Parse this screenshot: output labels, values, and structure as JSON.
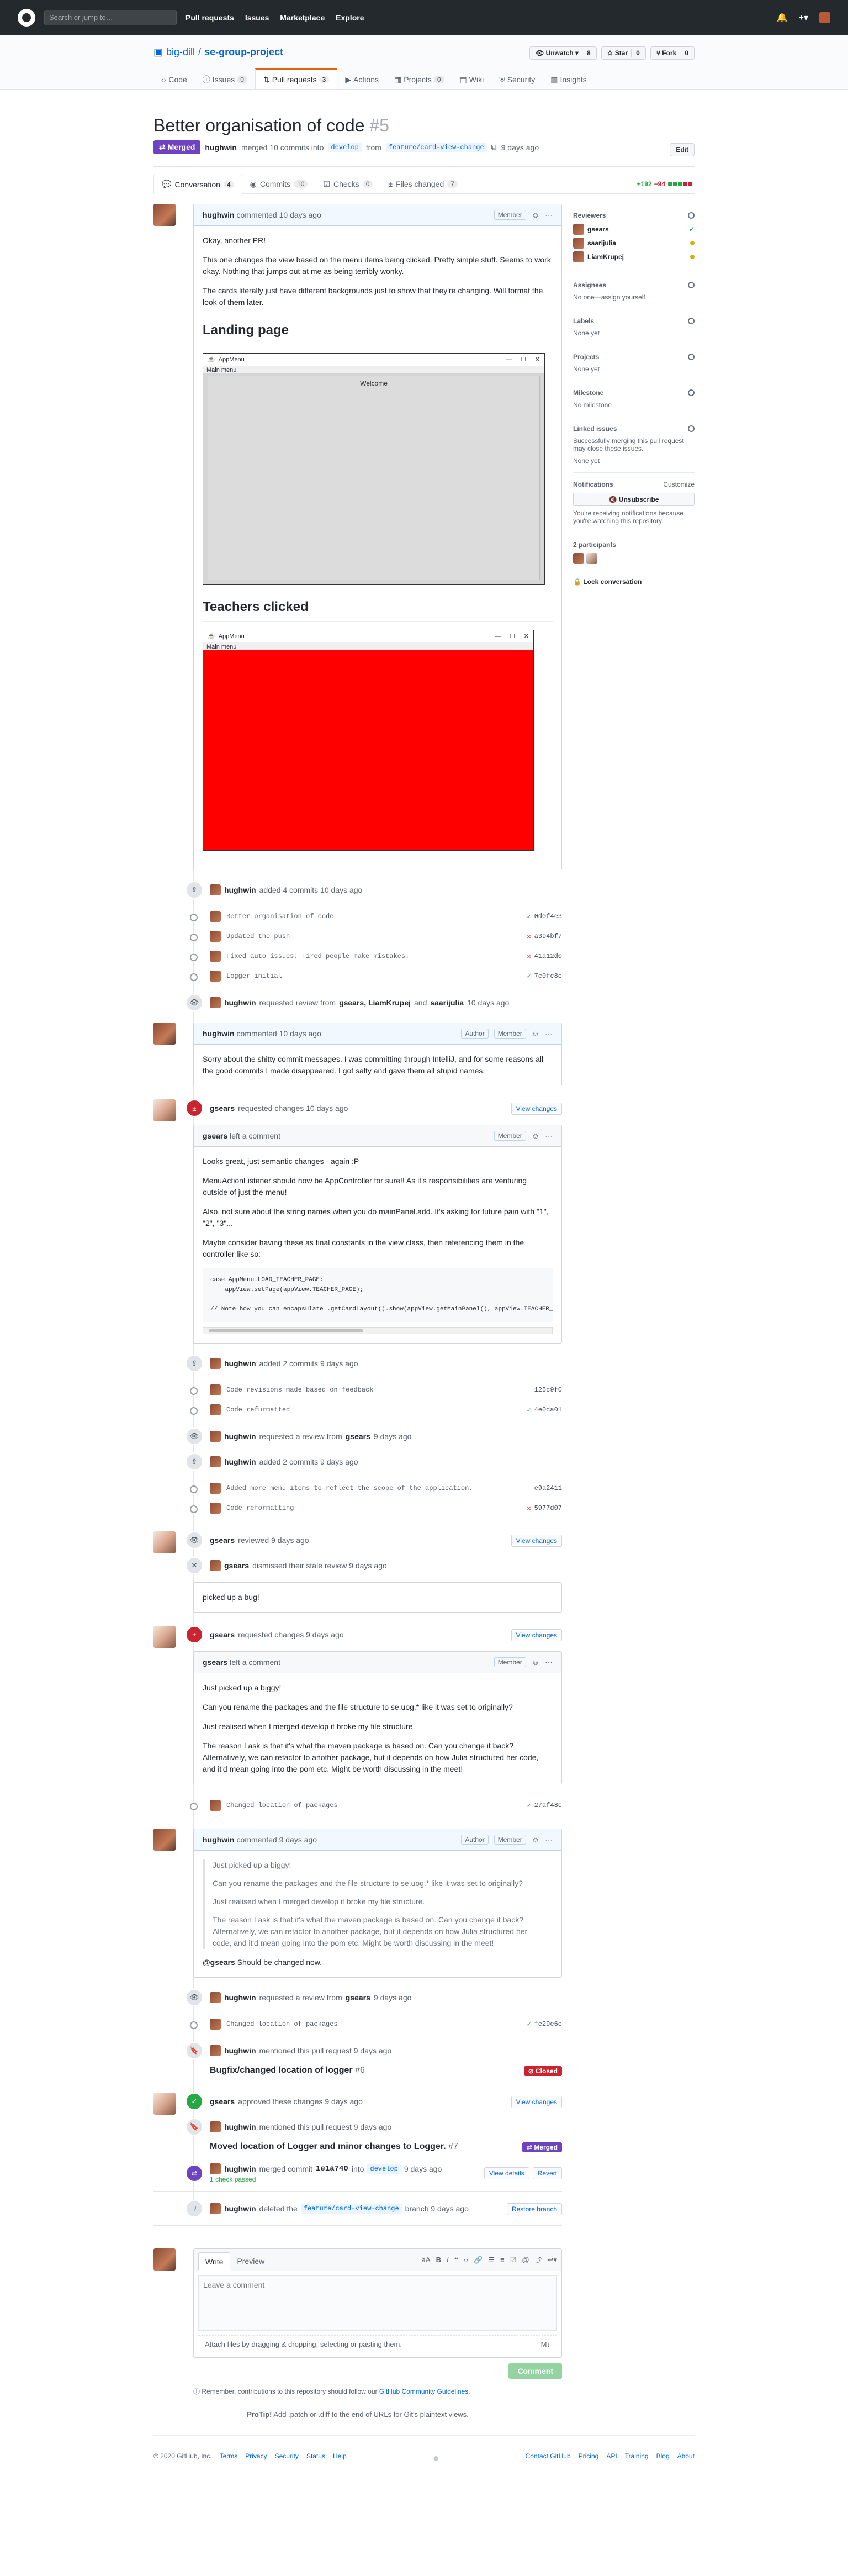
{
  "header": {
    "search_placeholder": "Search or jump to…",
    "nav": [
      "Pull requests",
      "Issues",
      "Marketplace",
      "Explore"
    ]
  },
  "repo": {
    "owner": "big-dill",
    "name": "se-group-project",
    "watch_label": "Unwatch",
    "watch_count": "8",
    "star_label": "Star",
    "star_count": "0",
    "fork_label": "Fork",
    "fork_count": "0",
    "tabs": [
      {
        "label": "Code",
        "count": ""
      },
      {
        "label": "Issues",
        "count": "0"
      },
      {
        "label": "Pull requests",
        "count": "3"
      },
      {
        "label": "Actions",
        "count": ""
      },
      {
        "label": "Projects",
        "count": "0"
      },
      {
        "label": "Wiki",
        "count": ""
      },
      {
        "label": "Security",
        "count": ""
      },
      {
        "label": "Insights",
        "count": ""
      }
    ]
  },
  "pr": {
    "title": "Better organisation of code",
    "number": "#5",
    "edit_label": "Edit",
    "state": "Merged",
    "author": "hughwin",
    "meta_merged": "merged 10 commits into",
    "base": "develop",
    "from": "from",
    "head": "feature/card-view-change",
    "when": "9 days ago",
    "tabs": [
      {
        "label": "Conversation",
        "count": "4"
      },
      {
        "label": "Commits",
        "count": "10"
      },
      {
        "label": "Checks",
        "count": "0"
      },
      {
        "label": "Files changed",
        "count": "7"
      }
    ],
    "additions": "+192",
    "deletions": "−94"
  },
  "first_comment": {
    "author": "hughwin",
    "action": "commented 10 days ago",
    "role": "Member",
    "p1": "Okay, another PR!",
    "p2": "This one changes the view based on the menu items being clicked. Pretty simple stuff. Seems to work okay. Nothing that jumps out at me as being terribly wonky.",
    "p3": "The cards literally just have different backgrounds just to show that they're changing. Will format the look of them later.",
    "h_landing": "Landing page",
    "app1_title": "AppMenu",
    "app1_menu": "Main menu",
    "app1_welcome": "Welcome",
    "h_teachers": "Teachers clicked",
    "app2_title": "AppMenu",
    "app2_menu": "Main menu"
  },
  "commits1": {
    "text": "added 4 commits 10 days ago",
    "author": "hughwin",
    "list": [
      {
        "msg": "Better organisation of code",
        "sha": "0d0f4e3",
        "ok": true
      },
      {
        "msg": "Updated the push",
        "sha": "a394bf7",
        "ok": false
      },
      {
        "msg": "Fixed auto issues. Tired people make mistakes.",
        "sha": "41a12d0",
        "ok": false
      },
      {
        "msg": "Logger initial",
        "sha": "7c0fc8c",
        "ok": true
      }
    ]
  },
  "review_req1": {
    "author": "hughwin",
    "text": "requested review from",
    "who": "gsears, LiamKrupej",
    "and": "and",
    "who2": "saarijulia",
    "when": "10 days ago"
  },
  "comment2": {
    "author": "hughwin",
    "action": "commented 10 days ago",
    "role1": "Author",
    "role2": "Member",
    "body": "Sorry about the shitty commit messages. I was committing through IntelliJ, and for some reasons all the good commits I made disappeared. I got salty and gave them all stupid names."
  },
  "changes1": {
    "author": "gsears",
    "text": "requested changes 10 days ago",
    "btn": "View changes"
  },
  "review1": {
    "author": "gsears",
    "action": "left a comment",
    "role": "Member",
    "p1": "Looks great, just semantic changes - again :P",
    "p2": "MenuActionListener should now be AppController for sure!! As it's responsibilities are venturing outside of just the menu!",
    "p3": "Also, not sure about the string names when you do mainPanel.add. It's asking for future pain with \"1\", \"2\", \"3\"...",
    "p4": "Maybe consider having these as final constants in the view class, then referencing them in the controller like so:",
    "code1": "case AppMenu.LOAD_TEACHER_PAGE:",
    "code2": "    appView.setPage(appView.TEACHER_PAGE);",
    "code3": "// Note how you can encapsulate .getCardLayout().show(appView.getMainPanel(), appView.TEACHER_PAGE"
  },
  "commits2": {
    "author": "hughwin",
    "text": "added 2 commits 9 days ago",
    "list": [
      {
        "msg": "Code revisions made based on feedback",
        "sha": "125c9f0",
        "ok": null
      },
      {
        "msg": "Code refurmatted",
        "sha": "4e0ca01",
        "ok": true
      }
    ]
  },
  "review_req2": {
    "author": "hughwin",
    "text": "requested a review from",
    "who": "gsears",
    "when": "9 days ago"
  },
  "commits3": {
    "author": "hughwin",
    "text": "added 2 commits 9 days ago",
    "list": [
      {
        "msg": "Added more menu items to reflect the scope of the application.",
        "sha": "e9a2411",
        "ok": null
      },
      {
        "msg": "Code reformatting",
        "sha": "5977d07",
        "ok": false
      }
    ]
  },
  "reviewed": {
    "author": "gsears",
    "text": "reviewed 9 days ago",
    "btn": "View changes"
  },
  "dismissed": {
    "author": "gsears",
    "text": "dismissed their stale review 9 days ago",
    "note": "picked up a bug!"
  },
  "changes2": {
    "author": "gsears",
    "text": "requested changes 9 days ago",
    "btn": "View changes"
  },
  "review2": {
    "author": "gsears",
    "action": "left a comment",
    "role": "Member",
    "p1": "Just picked up a biggy!",
    "p2": "Can you rename the packages and the file structure to se.uog.* like it was set to originally?",
    "p3": "Just realised when I merged develop it broke my file structure.",
    "p4": "The reason I ask is that it's what the maven package is based on. Can you change it back? Alternatively, we can refactor to another package, but it depends on how Julia structured her code, and it'd mean going into the pom etc. Might be worth discussing in the meet!"
  },
  "commit4": {
    "msg": "Changed location of packages",
    "sha": "27af48e",
    "ok": true
  },
  "comment3": {
    "author": "hughwin",
    "action": "commented 9 days ago",
    "role1": "Author",
    "role2": "Member",
    "q1": "Just picked up a biggy!",
    "q2": "Can you rename the packages and the file structure to se.uog.* like it was set to originally?",
    "q3": "Just realised when I merged develop it broke my file structure.",
    "q4": "The reason I ask is that it's what the maven package is based on. Can you change it back? Alternatively, we can refactor to another package, but it depends on how Julia structured her code, and it'd mean going into the pom etc. Might be worth discussing in the meet!",
    "reply_mention": "@gsears",
    "reply": "Should be changed now."
  },
  "review_req3": {
    "author": "hughwin",
    "text": "requested a review from",
    "who": "gsears",
    "when": "9 days ago"
  },
  "commit5": {
    "msg": "Changed location of packages",
    "sha": "fe29e6e",
    "ok": true
  },
  "mention1": {
    "author": "hughwin",
    "text": "mentioned this pull request 9 days ago",
    "ref": "Bugfix/changed location of logger",
    "num": "#6",
    "status": "Closed"
  },
  "approved": {
    "author": "gsears",
    "text": "approved these changes 9 days ago",
    "btn": "View changes"
  },
  "mention2": {
    "author": "hughwin",
    "text": "mentioned this pull request 9 days ago",
    "ref": "Moved location of Logger and minor changes to Logger.",
    "num": "#7",
    "status": "Merged"
  },
  "merged": {
    "author": "hughwin",
    "text": "merged commit",
    "sha": "1e1a740",
    "into": "into",
    "branch": "develop",
    "when": "9 days ago",
    "checks": "1 check passed",
    "btn1": "View details",
    "btn2": "Revert"
  },
  "deleted": {
    "author": "hughwin",
    "text": "deleted the",
    "branch": "feature/card-view-change",
    "rest": "branch 9 days ago",
    "btn": "Restore branch"
  },
  "compose": {
    "tab_write": "Write",
    "tab_preview": "Preview",
    "placeholder": "Leave a comment",
    "attach": "Attach files by dragging & dropping, selecting or pasting them.",
    "btn": "Comment",
    "guidelines_pre": "Remember, contributions to this repository should follow our",
    "guidelines_link": "GitHub Community Guidelines",
    "protip_pre": "ProTip!",
    "protip": "Add .patch or .diff to the end of URLs for Git's plaintext views."
  },
  "sidebar": {
    "reviewers_h": "Reviewers",
    "reviewers": [
      {
        "name": "gsears",
        "state": "approved"
      },
      {
        "name": "saarijulia",
        "state": "pending"
      },
      {
        "name": "LiamKrupej",
        "state": "pending"
      }
    ],
    "assignees_h": "Assignees",
    "assignees": "No one—assign yourself",
    "labels_h": "Labels",
    "labels": "None yet",
    "projects_h": "Projects",
    "projects": "None yet",
    "milestone_h": "Milestone",
    "milestone": "No milestone",
    "linked_h": "Linked issues",
    "linked": "Successfully merging this pull request may close these issues.",
    "linked2": "None yet",
    "notif_h": "Notifications",
    "notif_customize": "Customize",
    "unsub": "Unsubscribe",
    "notif_text": "You're receiving notifications because you're watching this repository.",
    "participants_h": "2 participants",
    "lock": "Lock conversation"
  },
  "footer": {
    "copyright": "© 2020 GitHub, Inc.",
    "left": [
      "Terms",
      "Privacy",
      "Security",
      "Status",
      "Help"
    ],
    "right": [
      "Contact GitHub",
      "Pricing",
      "API",
      "Training",
      "Blog",
      "About"
    ]
  }
}
